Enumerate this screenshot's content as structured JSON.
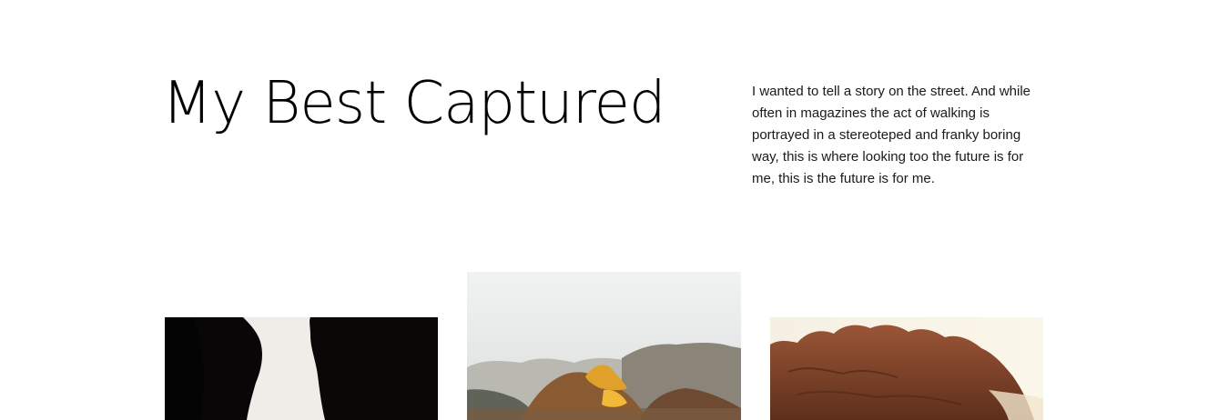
{
  "header": {
    "title": "My Best Captured",
    "description": "I wanted to tell a story on the street. And while often in magazines the act of walking is portrayed in a stereoteped and franky boring way, this is where looking too the future is for me, this is the future is for me."
  },
  "gallery": {
    "photos": [
      {
        "subject": "dark canyon rock silhouette"
      },
      {
        "subject": "desert rock formations at sunset"
      },
      {
        "subject": "red sandstone cliffs"
      }
    ]
  }
}
